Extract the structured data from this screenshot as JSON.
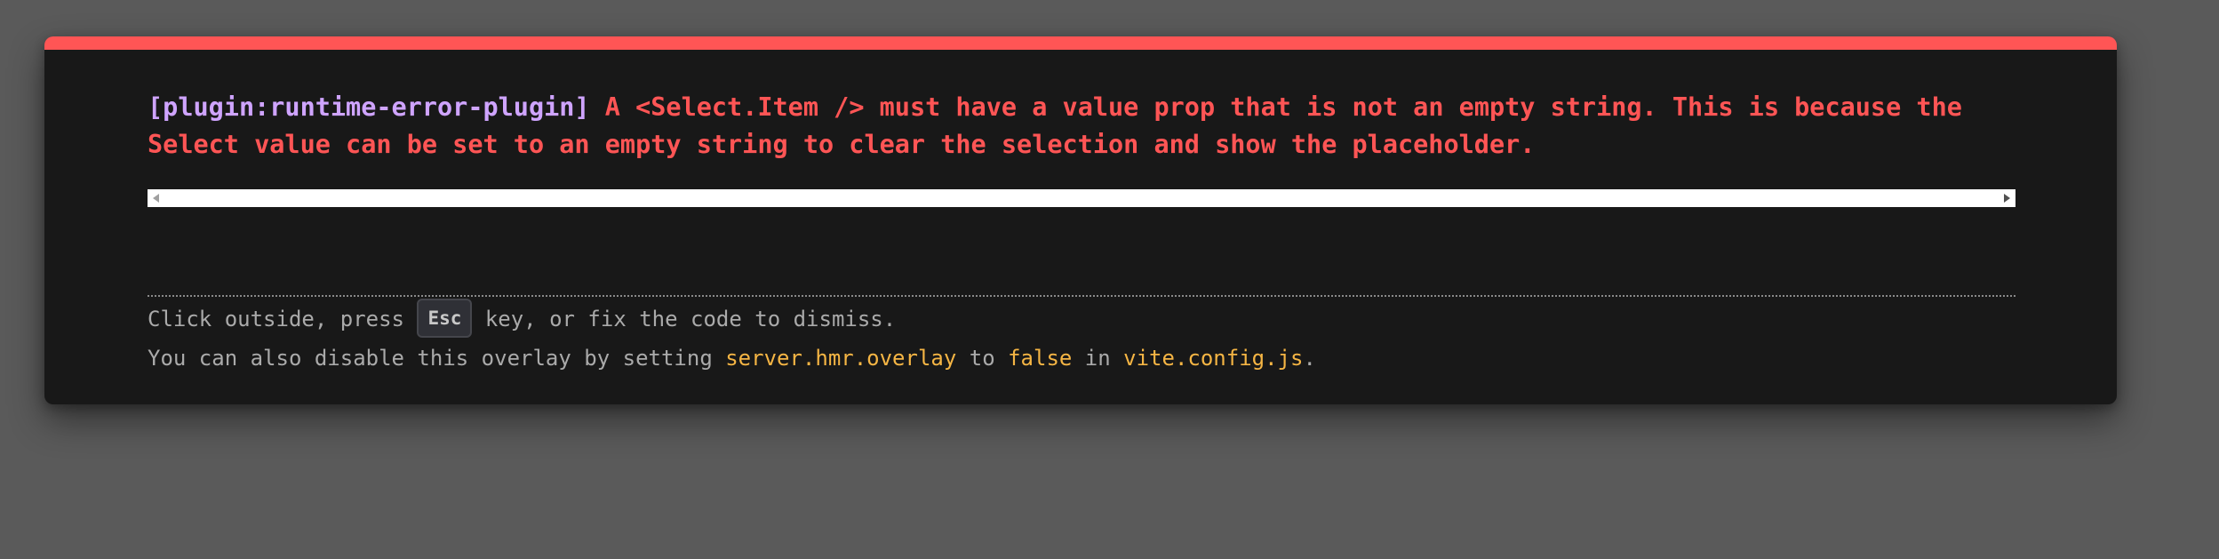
{
  "error": {
    "plugin": "[plugin:runtime-error-plugin]",
    "message": "A <Select.Item /> must have a value prop that is not an empty string. This is because the Select value can be set to an empty string to clear the selection and show the placeholder."
  },
  "tip": {
    "line1_before": "Click outside, press ",
    "key": "Esc",
    "line1_after": " key, or fix the code to dismiss.",
    "line2_before": "You can also disable this overlay by setting ",
    "setting": "server.hmr.overlay",
    "line2_mid1": " to ",
    "value": "false",
    "line2_mid2": " in ",
    "config_file": "vite.config.js",
    "line2_end": "."
  },
  "colors": {
    "accent_error": "#ff5555",
    "plugin_color": "#cfa4ff",
    "code_color": "#f5b544",
    "backdrop": "#5a5a5a",
    "window_bg": "#181818"
  },
  "icons": {
    "scroll_left": "triangle-left-icon",
    "scroll_right": "triangle-right-icon"
  }
}
